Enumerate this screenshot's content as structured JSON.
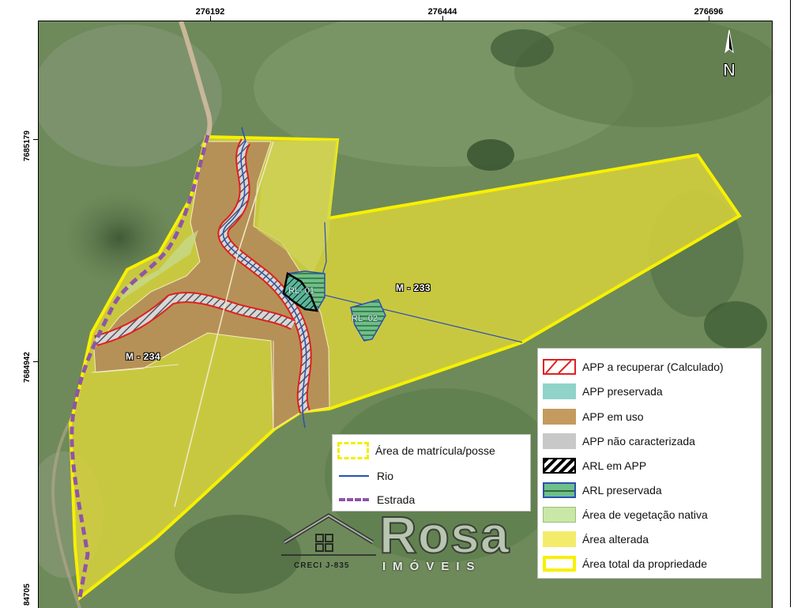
{
  "coordinates": {
    "top": [
      "276192",
      "276444",
      "276696"
    ],
    "left": [
      "7685179",
      "7684942",
      "84705"
    ]
  },
  "north_arrow": {
    "label": "N"
  },
  "parcels": [
    {
      "label": "M - 233"
    },
    {
      "label": "M - 234"
    }
  ],
  "reserves": [
    {
      "label": "RL- 01"
    },
    {
      "label": "RL- 02"
    }
  ],
  "legend_small": {
    "items": [
      {
        "label": "Área de matrícula/posse",
        "icon": "dashed-yellow-box",
        "color": "#f2ef00"
      },
      {
        "label": "Rio",
        "icon": "blue-line",
        "color": "#2a4fb5"
      },
      {
        "label": "Estrada",
        "icon": "purple-dashed-line",
        "color": "#8e55a8"
      }
    ]
  },
  "legend_main": {
    "items": [
      {
        "label": "APP a recuperar (Calculado)",
        "icon": "red-hatch",
        "color": "#e02020"
      },
      {
        "label": "APP preservada",
        "icon": "teal-fill",
        "color": "#8fd3c9"
      },
      {
        "label": "APP em uso",
        "icon": "tan-fill",
        "color": "#c49a5e"
      },
      {
        "label": "APP não caracterizada",
        "icon": "gray-fill",
        "color": "#c8c8c8"
      },
      {
        "label": "ARL em APP",
        "icon": "black-hatch",
        "color": "#000000"
      },
      {
        "label": "ARL preservada",
        "icon": "green-line-fill",
        "color": "#3f8a4a"
      },
      {
        "label": "Área de vegetação nativa",
        "icon": "light-green-fill",
        "color": "#c9e7a7"
      },
      {
        "label": "Área alterada",
        "icon": "yellow-fill",
        "color": "#f3ec6a"
      },
      {
        "label": "Área total da propriedade",
        "icon": "yellow-outline",
        "color": "#f7f000"
      }
    ]
  },
  "watermark": {
    "brand": "Rosa",
    "subtitle": "IMÓVEIS",
    "creci": "CRECI J-835"
  }
}
